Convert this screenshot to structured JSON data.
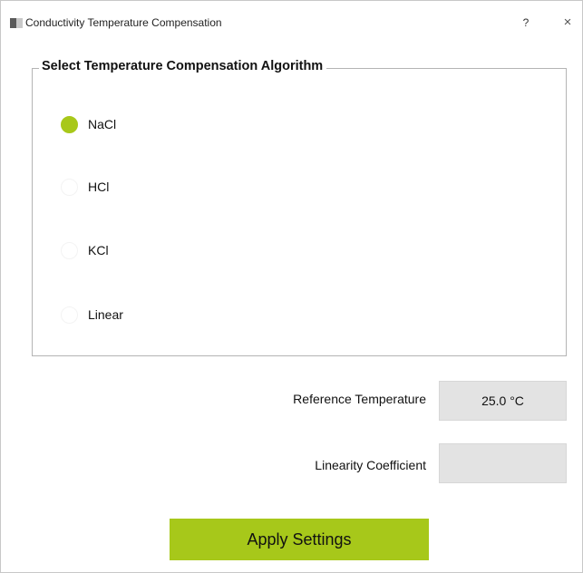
{
  "window": {
    "title": "Conductivity Temperature Compensation",
    "help_label": "?",
    "close_label": "×"
  },
  "algorithm_group": {
    "title": "Select Temperature Compensation Algorithm",
    "options": [
      {
        "label": "NaCl",
        "checked": true
      },
      {
        "label": "HCl",
        "checked": false
      },
      {
        "label": "KCl",
        "checked": false
      },
      {
        "label": "Linear",
        "checked": false
      }
    ]
  },
  "reference_temperature": {
    "label": "Reference Temperature",
    "value": "25.0 °C"
  },
  "linearity_coefficient": {
    "label": "Linearity Coefficient",
    "value": ""
  },
  "apply_button": {
    "label": "Apply Settings"
  },
  "colors": {
    "accent": "#a7c81a",
    "field_background": "#e3e3e3"
  }
}
